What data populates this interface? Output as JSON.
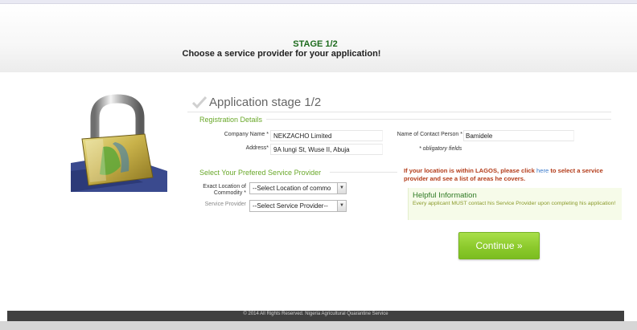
{
  "header": {
    "stage_title": "STAGE 1/2",
    "subtitle": "Choose a service provider for your application!"
  },
  "main": {
    "application_stage": "Application stage 1/2",
    "registration": {
      "legend": "Registration Details",
      "company_name_label": "Company Name *",
      "company_name_value": "NEKZACHO Limited",
      "address_label": "Address*",
      "address_value": "9A Iungi St, Wuse II, Abuja",
      "contact_person_label": "Name of Contact Person *",
      "contact_person_value": "Bamidele",
      "obligatory_note": "* obligatory fields"
    },
    "provider": {
      "legend": "Select Your Prefered Service Provider",
      "location_label_line1": "Exact Location of",
      "location_label_line2": "Commodity *",
      "location_select": "--Select Location of commo",
      "provider_label": "Service Provider",
      "provider_select": "--Select Service Provider--"
    },
    "lagos_notice": {
      "before": "If your location is within LAGOS, please click ",
      "link": "here",
      "after": " to select a service provider and see a list of areas he covers."
    },
    "help": {
      "title": "Helpful Information",
      "text": "Every applicant MUST contact his Service Provider upon completing his application!"
    },
    "continue_label": "Continue »"
  },
  "footer": {
    "text": "© 2014 All Rights Reserved. Nigeria Agricultural Quarantine Service"
  },
  "icons": {
    "check": "checkmark-icon",
    "lock": "padlock-icon"
  }
}
